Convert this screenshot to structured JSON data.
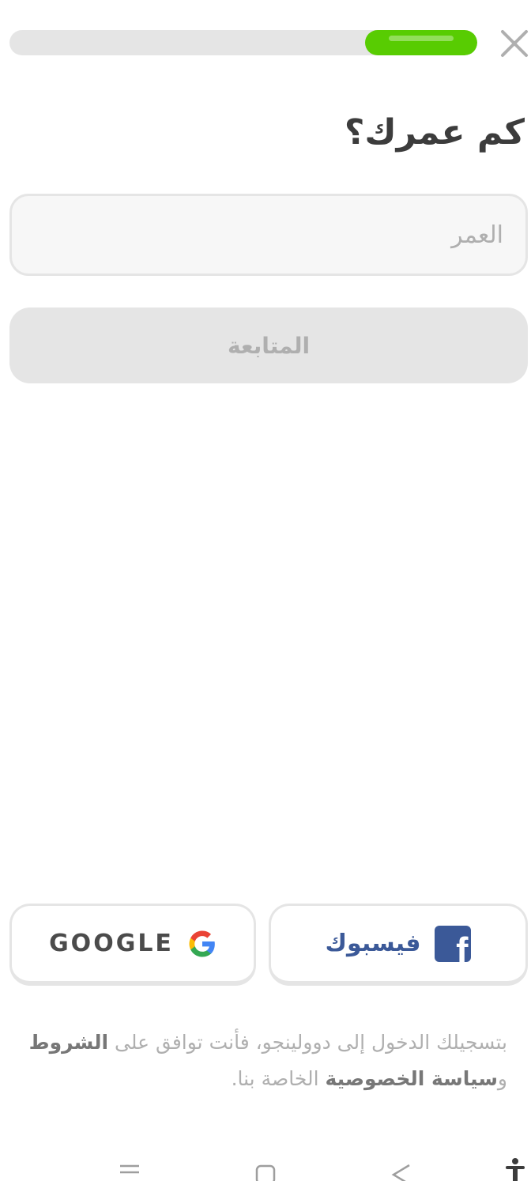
{
  "progress": {
    "fraction": 0.24,
    "color": "#58cc02"
  },
  "header": {
    "close_icon": "close-icon"
  },
  "question": {
    "title": "كم عمرك؟"
  },
  "age_input": {
    "placeholder": "العمر",
    "value": ""
  },
  "continue_button": {
    "label": "المتابعة"
  },
  "social": {
    "google_label": "GOOGLE",
    "google_icon": "google-g-icon",
    "facebook_label": "فيسبوك",
    "facebook_icon": "facebook-icon",
    "facebook_color": "#3b5998"
  },
  "legal": {
    "prefix": "بتسجيلك الدخول إلى دوولينجو، فأنت توافق على",
    "terms_link": "الشروط",
    "and": "و",
    "privacy_link": "سياسة الخصوصية",
    "suffix": "الخاصة بنا."
  },
  "system_nav": {
    "icons": [
      "recent-apps-icon",
      "home-icon",
      "back-icon",
      "accessibility-icon"
    ]
  }
}
